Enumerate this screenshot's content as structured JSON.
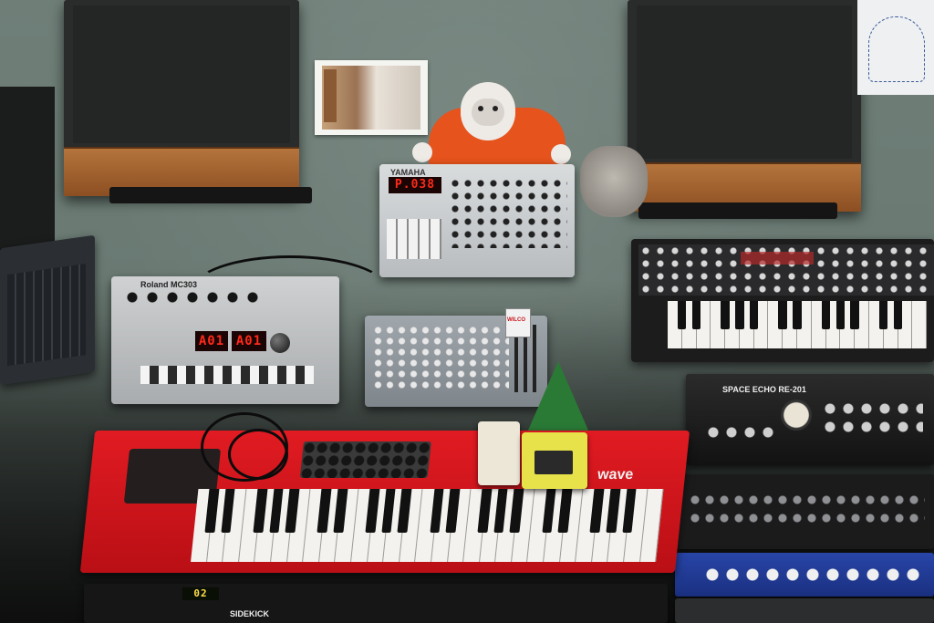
{
  "scene": {
    "gear": {
      "mc303": {
        "brand": "Roland MC303",
        "display_left": "A01",
        "display_right": "A01"
      },
      "an200": {
        "brand": "YAMAHA",
        "display": "P.038"
      },
      "nord": {
        "badge": "wave"
      },
      "space_echo": {
        "model": "SPACE ECHO  RE-201"
      },
      "sidekick": {
        "label": "SIDEKICK"
      },
      "rack_display": {
        "value": "02"
      },
      "flyer": {
        "label": "WILCO"
      }
    },
    "colors": {
      "wall": "#6f7f78",
      "nord_red": "#d8161c",
      "speaker_wood": "#a3622e",
      "plush_orange": "#e6531d",
      "echo_blue": "#1f3a8c"
    }
  }
}
